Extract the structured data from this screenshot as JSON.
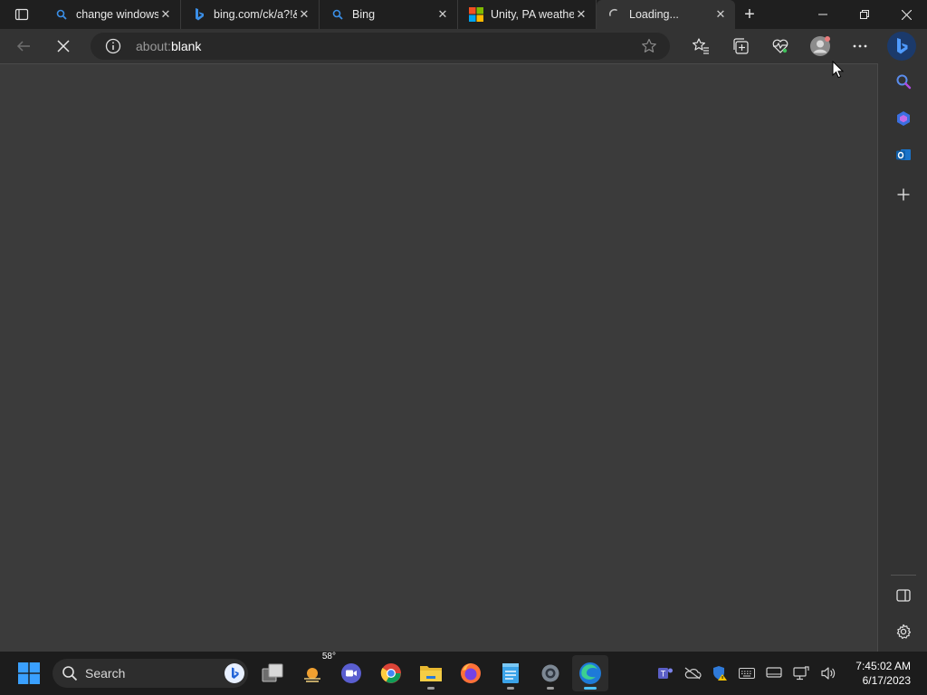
{
  "browser": {
    "tabs": [
      {
        "title": "change windows",
        "favicon": "search-icon",
        "active": false
      },
      {
        "title": "bing.com/ck/a?!&",
        "favicon": "bing-icon",
        "active": false
      },
      {
        "title": "Bing",
        "favicon": "search-icon",
        "active": false
      },
      {
        "title": "Unity, PA weathe",
        "favicon": "microsoft-icon",
        "active": false
      },
      {
        "title": "Loading...",
        "favicon": "loading-spinner-icon",
        "active": true
      }
    ],
    "new_tab": "+",
    "address": {
      "prefix": "about:",
      "highlight": "blank"
    },
    "toolbar_icons": [
      "favorites-icon",
      "collections-icon",
      "performance-icon",
      "profile-icon",
      "more-icon"
    ]
  },
  "sidebar": {
    "items": [
      "search-icon",
      "copilot-icon",
      "outlook-icon",
      "add-icon"
    ],
    "bottom": [
      "split-screen-icon",
      "settings-icon"
    ]
  },
  "taskbar": {
    "search_label": "Search",
    "weather_temp": "58°",
    "clock_time": "7:45:02 AM",
    "clock_date": "6/17/2023"
  },
  "colors": {
    "tabstrip": "#1f1f1f",
    "toolbar": "#333333",
    "content": "#3b3b3b",
    "accent": "#4cc2ff"
  }
}
